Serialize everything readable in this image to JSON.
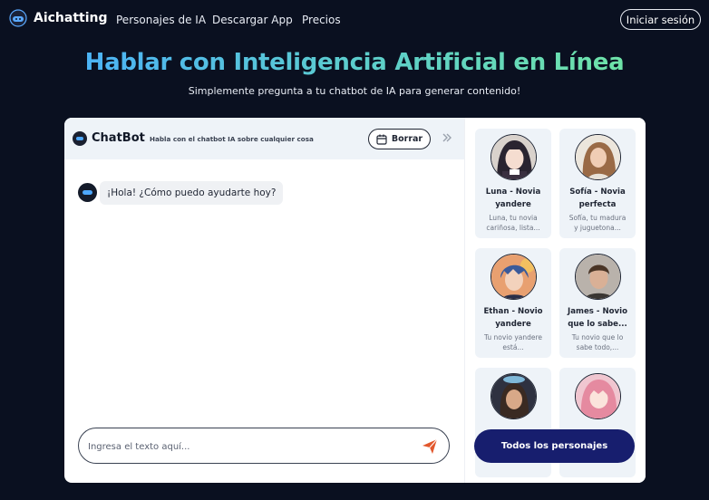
{
  "nav": {
    "brand": "Aichatting",
    "links": [
      "Personajes de IA",
      "Descargar App",
      "Precios"
    ],
    "login_label": "Iniciar sesión"
  },
  "hero": {
    "title_part1": "Hablar con Inteligencia",
    "title_part2": "Artificial en Línea",
    "subtitle": "Simplemente pregunta a tu chatbot de IA para generar contenido!"
  },
  "chat": {
    "title": "ChatBot",
    "description": "Habla con el chatbot IA sobre cualquier cosa",
    "clear_label": "Borrar",
    "messages": [
      {
        "sender": "bot",
        "text": "¡Hola! ¿Cómo puedo ayudarte hoy?"
      }
    ],
    "input_placeholder": "Ingresa el texto aquí..."
  },
  "characters": {
    "items": [
      {
        "name_line1": "Luna - Novia",
        "name_line2": "yandere",
        "desc_line1": "Luna, tu novia",
        "desc_line2": "cariñosa, lista..."
      },
      {
        "name_line1": "Sofía - Novia",
        "name_line2": "perfecta",
        "desc_line1": "Sofía, tu madura",
        "desc_line2": "y juguetona..."
      },
      {
        "name_line1": "Ethan - Novio",
        "name_line2": "yandere",
        "desc_line1": "Tu novio yandere",
        "desc_line2": "está..."
      },
      {
        "name_line1": "James - Novio",
        "name_line2": "que lo sabe...",
        "desc_line1": "Tu novio que lo",
        "desc_line2": "sabe todo,..."
      },
      {
        "name_line1": "",
        "name_line2": "",
        "desc_line1": "",
        "desc_line2": ""
      },
      {
        "name_line1": "",
        "name_line2": "",
        "desc_line1": "",
        "desc_line2": ""
      }
    ],
    "all_label": "Todos los personajes"
  },
  "colors": {
    "background": "#0a1020",
    "accent_button": "#171e6e",
    "send_icon": "#e2572c",
    "title_gradient_start": "#4cb3f5",
    "title_gradient_mid": "#5ed0c8",
    "title_gradient_end": "#6ee3a8"
  }
}
